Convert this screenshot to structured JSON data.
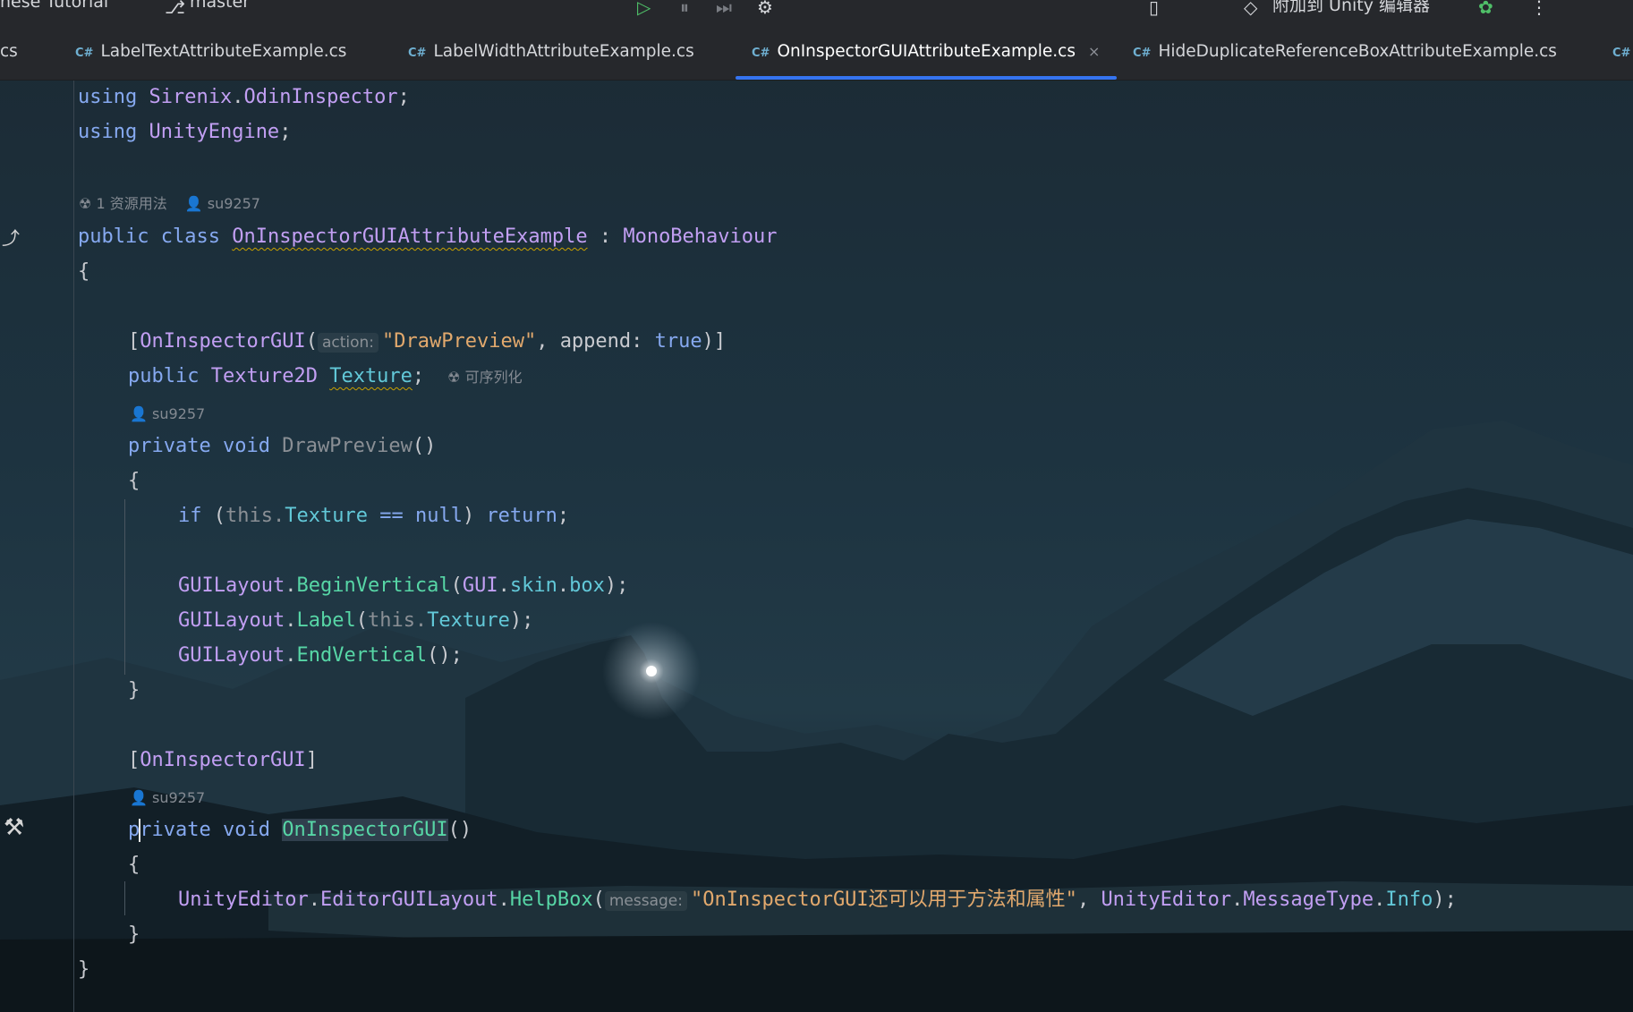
{
  "toolbar": {
    "project": "nese Tutorial",
    "branch": "master",
    "attach_label": "附加到 Unity 编辑器"
  },
  "tabs": [
    {
      "label": "cs",
      "lang": ""
    },
    {
      "label": "LabelTextAttributeExample.cs",
      "lang": "C#"
    },
    {
      "label": "LabelWidthAttributeExample.cs",
      "lang": "C#"
    },
    {
      "label": "OnInspectorGUIAttributeExample.cs",
      "lang": "C#",
      "active": true,
      "close": "×"
    },
    {
      "label": "HideDuplicateReferenceBoxAttributeExample.cs",
      "lang": "C#"
    },
    {
      "label": "",
      "lang": "C#"
    }
  ],
  "lens": {
    "class_usages": "1 资源用法",
    "author": "su9257",
    "serializable": "可序列化"
  },
  "code": {
    "using": "using",
    "ns1": "Sirenix",
    "ns1b": "OdinInspector",
    "ns2": "UnityEngine",
    "public": "public",
    "class": "class",
    "class_name": "OnInspectorGUIAttributeExample",
    "colon": ":",
    "base": "MonoBehaviour",
    "brace_open": "{",
    "brace_close": "}",
    "attr1_name": "OnInspectorGUI",
    "hint_action": "action:",
    "attr1_arg": "\"DrawPreview\"",
    "append_label": "append:",
    "true": "true",
    "field_type": "Texture2D",
    "field_name": "Texture",
    "private": "private",
    "void": "void",
    "method1": "DrawPreview",
    "if": "if",
    "this": "this.",
    "texture": "Texture",
    "eq": "==",
    "null": "null",
    "return": "return",
    "guilayout": "GUILayout",
    "begin_vertical": "BeginVertical",
    "gui": "GUI",
    "skin": "skin",
    "box": "box",
    "label": "Label",
    "end_vertical": "EndVertical",
    "attr2": "OnInspectorGUI",
    "method2": "OnInspectorGUI",
    "unity_editor": "UnityEditor",
    "editor_gui_layout": "EditorGUILayout",
    "helpbox": "HelpBox",
    "hint_message": "message:",
    "helpbox_msg": "\"OnInspectorGUI还可以用于方法和属性\"",
    "message_type": "MessageType",
    "info": "Info"
  },
  "colors": {
    "keyword": "#86a9f0",
    "type": "#c29ff3",
    "method": "#57d6a6",
    "string": "#e2a96d",
    "property": "#62c8d8",
    "accent": "#3574f0"
  },
  "icons": [
    "run-icon",
    "debug-icon",
    "step-icon",
    "unity-icon",
    "branch-icon",
    "user-icon",
    "usages-icon",
    "hammer-icon",
    "implement-icon"
  ]
}
